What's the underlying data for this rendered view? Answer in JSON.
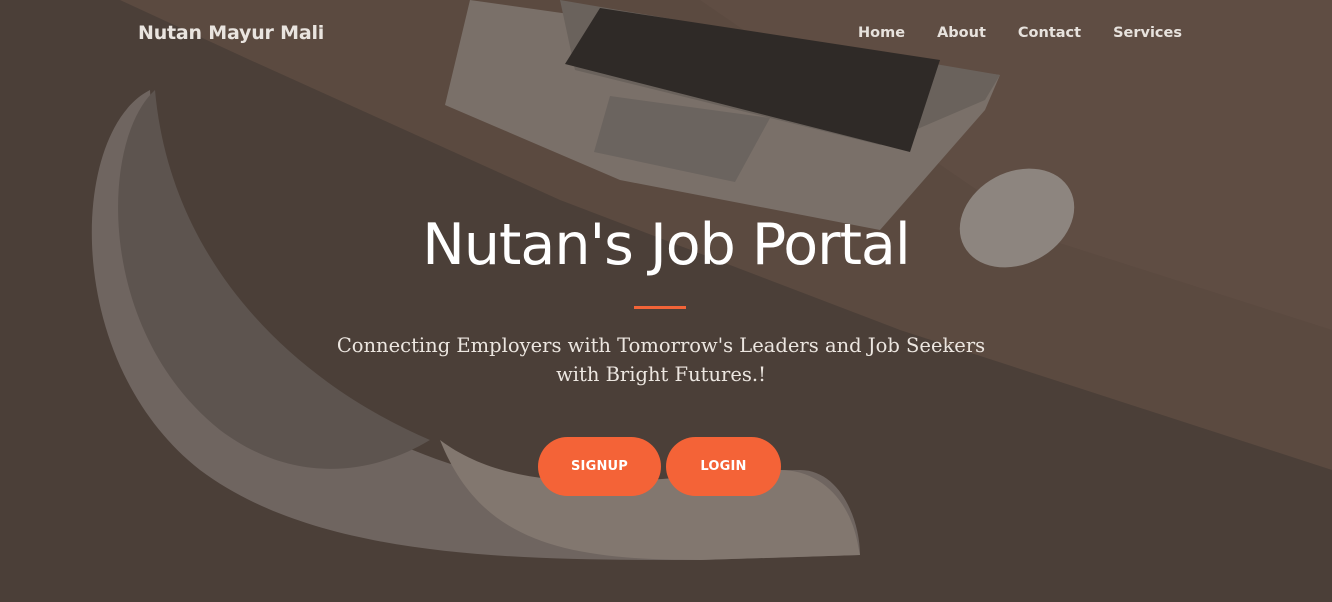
{
  "brand": {
    "name": "Nutan Mayur Mali"
  },
  "nav": {
    "items": [
      {
        "label": "Home"
      },
      {
        "label": "About"
      },
      {
        "label": "Contact"
      },
      {
        "label": "Services"
      }
    ]
  },
  "hero": {
    "title": "Nutan's Job Portal",
    "subtitle": "Connecting Employers with Tomorrow's Leaders and Job Seekers with Bright Futures.!",
    "signup_label": "SIGNUP",
    "login_label": "LOGIN",
    "background_image": "laptop-desk-chair-photo"
  },
  "colors": {
    "accent": "#f46337",
    "overlay": "#4a3f38",
    "text": "#ffffff"
  }
}
